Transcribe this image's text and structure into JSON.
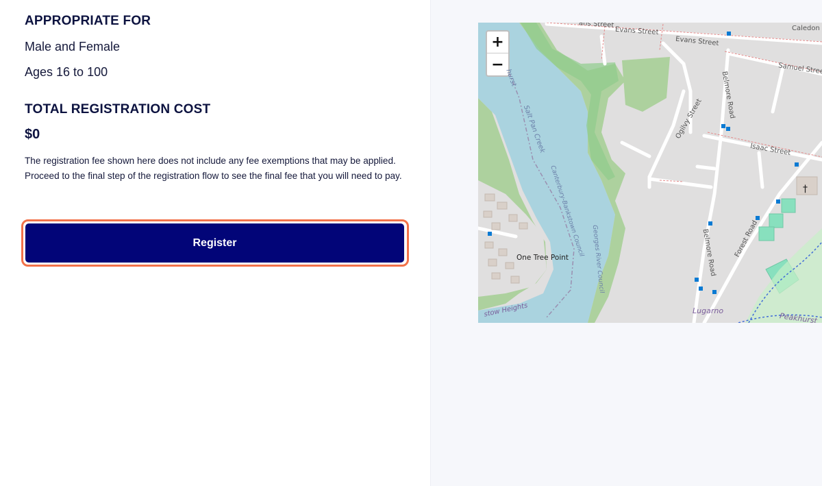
{
  "details": {
    "appropriate_heading": "APPROPRIATE FOR",
    "gender": "Male and Female",
    "ages": "Ages 16 to 100",
    "cost_heading": "TOTAL REGISTRATION COST",
    "cost_value": "$0",
    "disclaimer": "The registration fee shown here does not include any fee exemptions that may be applied. Proceed to the final step of the registration flow to see the final fee that you will need to pay.",
    "register_label": "Register"
  },
  "map": {
    "zoom_in": "+",
    "zoom_out": "−",
    "labels": {
      "evans_street_1": "Evans Street",
      "evans_street_2": "Evans Street",
      "evans_street_partial": "ans Street",
      "caledon": "Caledon",
      "samuel_street": "Samuel Stree",
      "belmore_road_north": "Belmore Road",
      "ogilvy_street": "Ogilvy Street",
      "isaac_street": "Isaac Street",
      "salt_pan_creek": "Salt Pan Creek",
      "council": "Canterbury-Bankstown Council",
      "georges_river": "Georges River Council",
      "one_tree_point": "One Tree Point",
      "belmore_road_south": "Belmore Road",
      "forest_road": "Forest Road",
      "lugarno": "Lugarno",
      "peakhurst": "Peakhurst",
      "heights": "stow Heights",
      "hurst": "hurst"
    },
    "colors": {
      "water": "#aad3df",
      "park": "#add19e",
      "land": "#e0dfdf",
      "road": "#ffffff",
      "pitch": "#88e0be",
      "bus_stop": "#0a7ad3"
    }
  }
}
